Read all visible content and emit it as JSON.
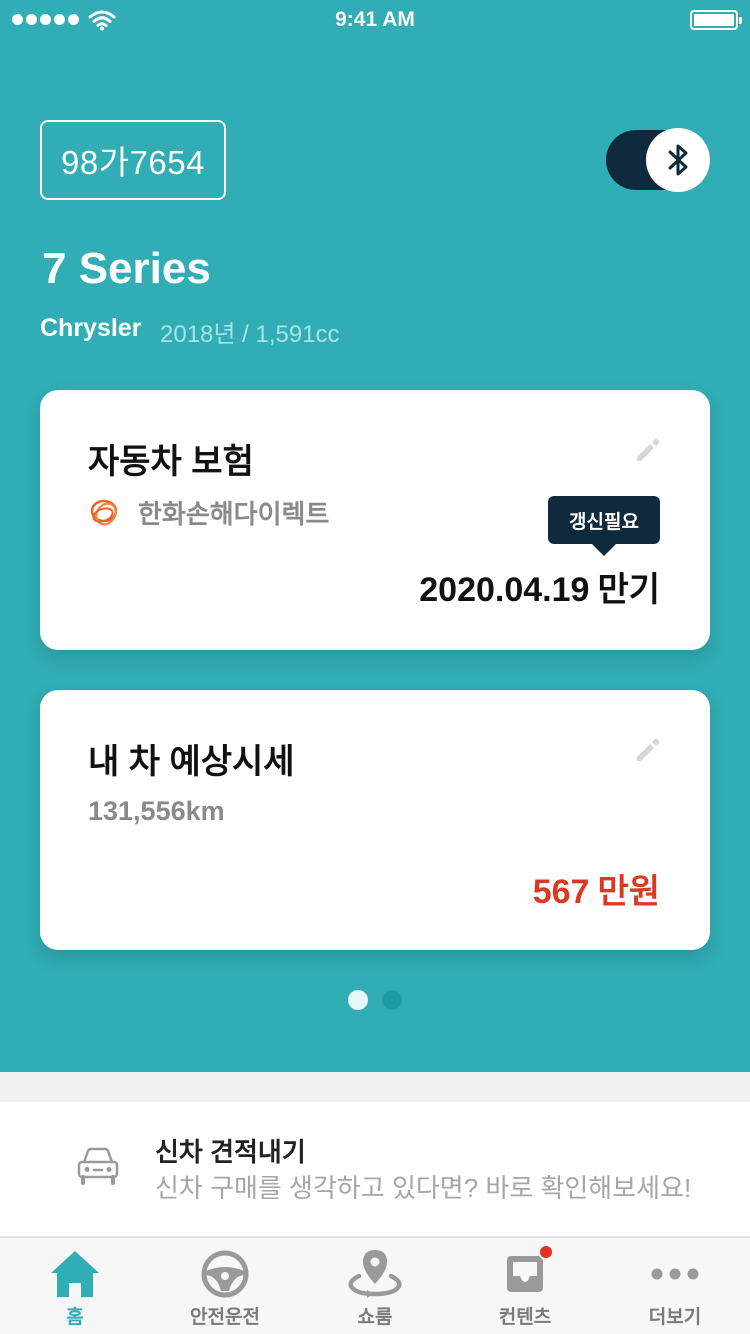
{
  "status_bar": {
    "time": "9:41 AM"
  },
  "vehicle": {
    "plate": "98가7654",
    "model": "7 Series",
    "maker": "Chrysler",
    "spec": "2018년 / 1,591cc"
  },
  "cards": {
    "insurance": {
      "title": "자동차 보험",
      "insurer": "한화손해다이렉트",
      "badge": "갱신필요",
      "expiry_date": "2020.04.19",
      "expiry_unit": "만기"
    },
    "valuation": {
      "title": "내 차 예상시세",
      "mileage": "131,556km",
      "price_value": "567",
      "price_unit": "만원"
    }
  },
  "pager": {
    "total": 2,
    "current": 1
  },
  "promo": {
    "title": "신차 견적내기",
    "subtitle": "신차 구매를 생각하고 있다면? 바로 확인해보세요!"
  },
  "tabs": [
    {
      "label": "홈",
      "icon": "home-icon",
      "active": true
    },
    {
      "label": "안전운전",
      "icon": "steering-wheel-icon",
      "active": false
    },
    {
      "label": "쇼룸",
      "icon": "location-pin-icon",
      "active": false
    },
    {
      "label": "컨텐츠",
      "icon": "inbox-icon",
      "active": false,
      "has_new": true
    },
    {
      "label": "더보기",
      "icon": "more-icon",
      "active": false
    }
  ],
  "colors": {
    "primary": "#31aeb5",
    "dark": "#0f2a3d",
    "price": "#d83a22",
    "notification": "#e2321c"
  }
}
